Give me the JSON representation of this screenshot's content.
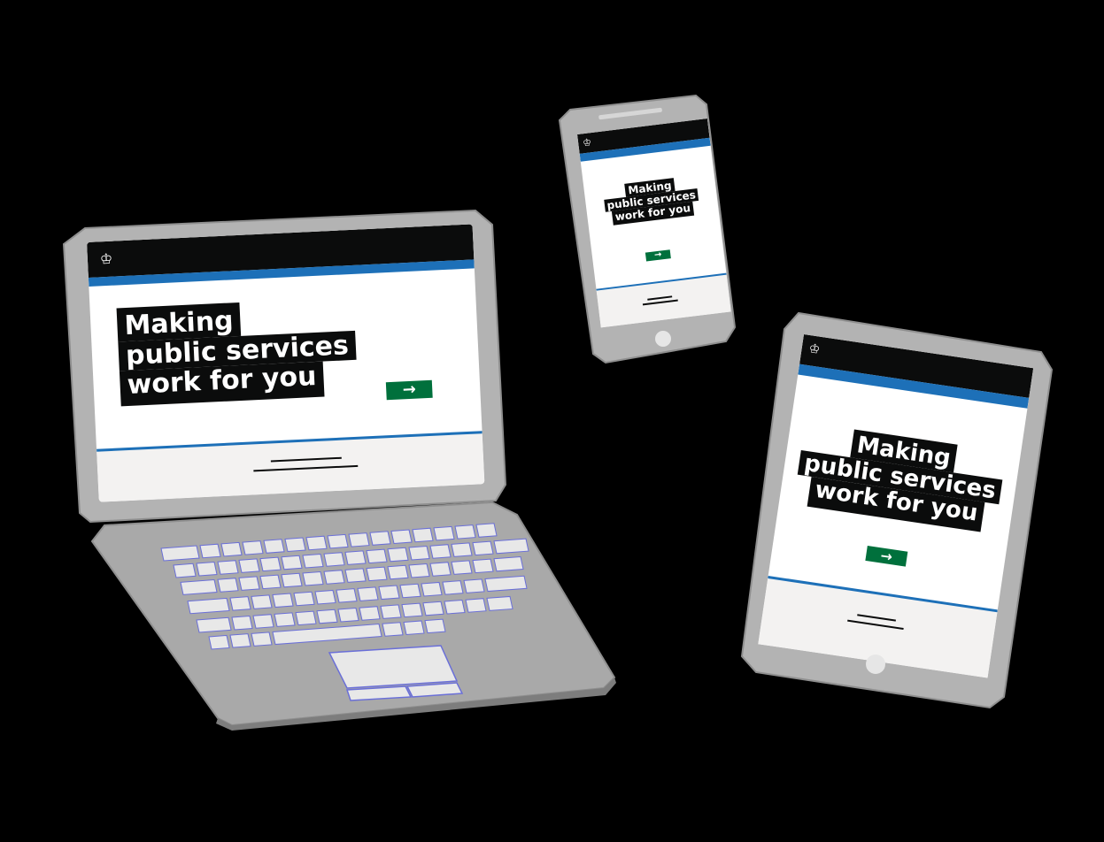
{
  "hero": {
    "line1": "Making",
    "line2": "public services",
    "line3": "work for you",
    "cta_arrow": "→"
  },
  "icons": {
    "crown": "crown-icon",
    "arrow": "arrow-right-icon"
  },
  "colors": {
    "background": "#000000",
    "device_body": "#b3b3b3",
    "header": "#0b0c0c",
    "accent_blue": "#1d70b8",
    "cta_green": "#00703c",
    "footer": "#f3f2f1"
  }
}
